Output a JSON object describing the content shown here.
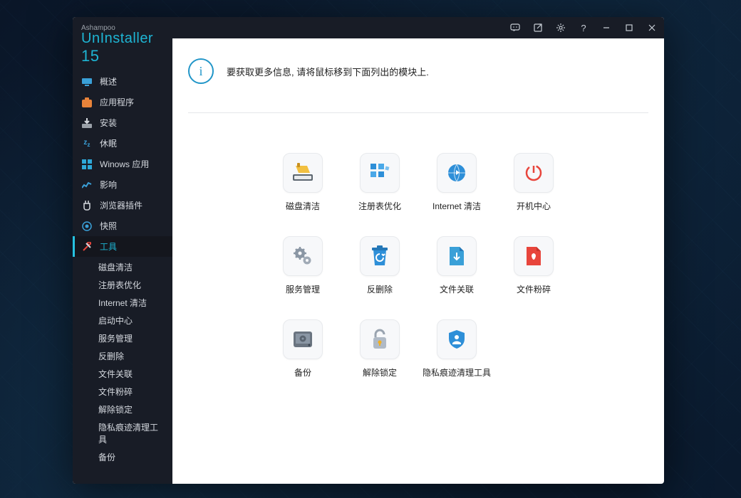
{
  "brand": {
    "top": "Ashampoo",
    "main": "UnInstaller",
    "version": "15"
  },
  "info": {
    "text": "要获取更多信息, 请将鼠标移到下面列出的模块上."
  },
  "nav": [
    {
      "label": "概述",
      "icon": "overview"
    },
    {
      "label": "应用程序",
      "icon": "apps"
    },
    {
      "label": "安装",
      "icon": "install"
    },
    {
      "label": "休眠",
      "icon": "sleep"
    },
    {
      "label": "Winows 应用",
      "icon": "windows"
    },
    {
      "label": "影响",
      "icon": "impact"
    },
    {
      "label": "浏览器插件",
      "icon": "plugins"
    },
    {
      "label": "快照",
      "icon": "snapshot"
    },
    {
      "label": "工具",
      "icon": "tools",
      "active": true
    }
  ],
  "subnav": [
    "磁盘清洁",
    "注册表优化",
    "Internet 清洁",
    "启动中心",
    "服务管理",
    "反删除",
    "文件关联",
    "文件粉碎",
    "解除锁定",
    "隐私痕迹清理工具",
    "备份"
  ],
  "tools": [
    {
      "label": "磁盘清洁",
      "icon": "disk-clean"
    },
    {
      "label": "注册表优化",
      "icon": "registry"
    },
    {
      "label": "Internet 清洁",
      "icon": "internet-clean"
    },
    {
      "label": "开机中心",
      "icon": "boot"
    },
    {
      "label": "服务管理",
      "icon": "service"
    },
    {
      "label": "反删除",
      "icon": "undelete"
    },
    {
      "label": "文件关联",
      "icon": "file-assoc"
    },
    {
      "label": "文件粉碎",
      "icon": "shred"
    },
    {
      "label": "备份",
      "icon": "backup"
    },
    {
      "label": "解除锁定",
      "icon": "unlock"
    },
    {
      "label": "隐私痕迹清理工具",
      "icon": "privacy"
    }
  ]
}
